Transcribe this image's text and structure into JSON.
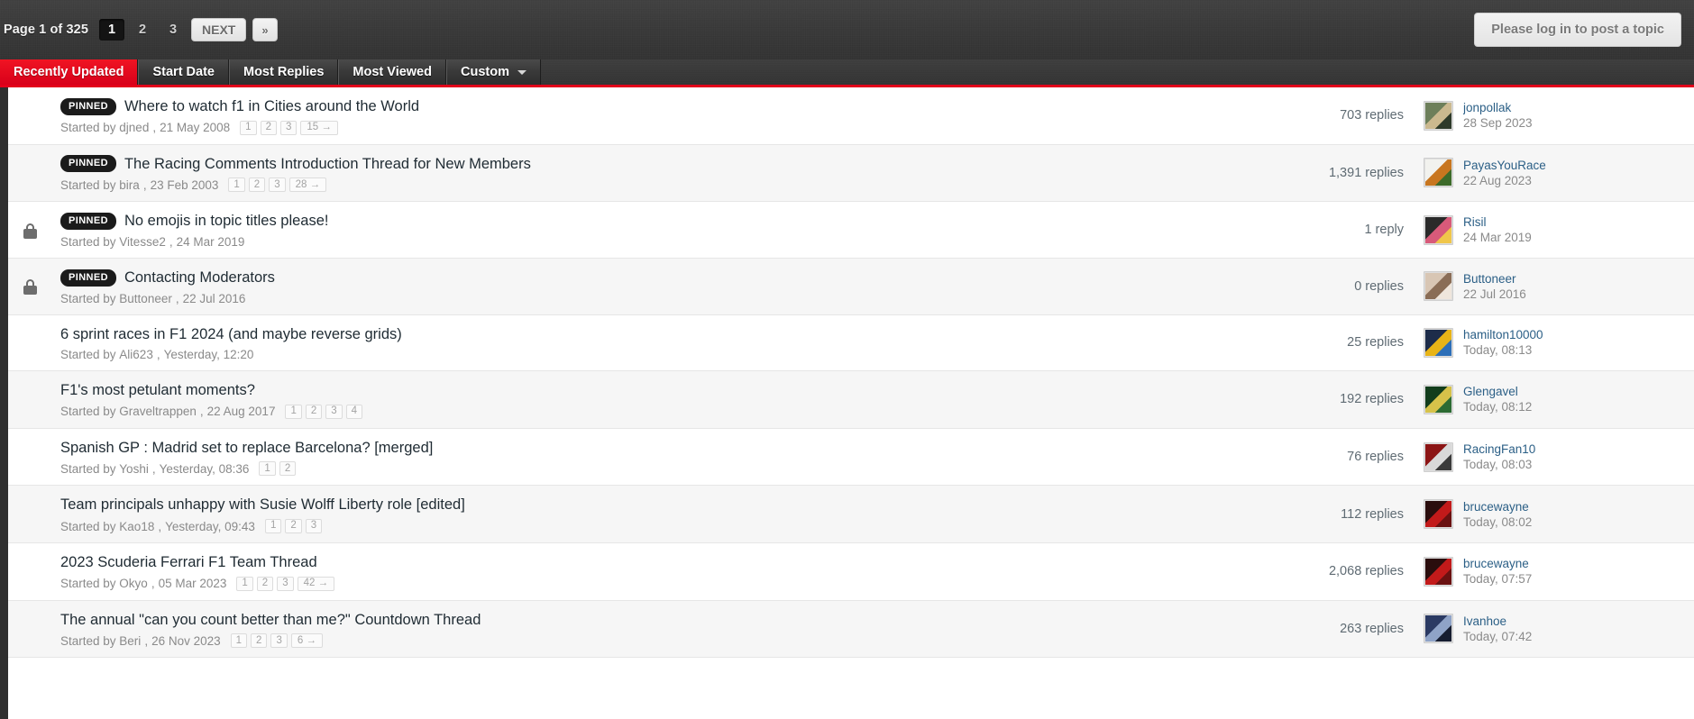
{
  "header": {
    "page_label": "Page 1 of 325",
    "pages": [
      "1",
      "2",
      "3"
    ],
    "active_page": "1",
    "next_label": "NEXT",
    "last_label": "»",
    "login_button": "Please log in to post a topic"
  },
  "tabs": [
    {
      "label": "Recently Updated",
      "active": true,
      "caret": false
    },
    {
      "label": "Start Date",
      "active": false,
      "caret": false
    },
    {
      "label": "Most Replies",
      "active": false,
      "caret": false
    },
    {
      "label": "Most Viewed",
      "active": false,
      "caret": false
    },
    {
      "label": "Custom",
      "active": false,
      "caret": true
    }
  ],
  "labels": {
    "started_by": "Started by",
    "comma": ",",
    "pinned": "PINNED"
  },
  "colors": {
    "accent_red": "#e2001a",
    "topbar_dark": "#3b3b3b",
    "link_blue": "#2b5f86",
    "muted_gray": "#8a8a8a"
  },
  "topics": [
    {
      "pinned": true,
      "locked": false,
      "title": "Where to watch f1 in Cities around the World",
      "starter": "djned",
      "start_date": "21 May 2008",
      "minipages": [
        "1",
        "2",
        "3",
        "15 →"
      ],
      "replies": "703 replies",
      "last_user": "jonpollak",
      "last_date": "28 Sep 2023",
      "avatar": "photo-portrait"
    },
    {
      "pinned": true,
      "locked": false,
      "title": "The Racing Comments Introduction Thread for New Members",
      "starter": "bira",
      "start_date": "23 Feb 2003",
      "minipages": [
        "1",
        "2",
        "3",
        "28 →"
      ],
      "replies": "1,391 replies",
      "last_user": "PayasYouRace",
      "last_date": "22 Aug 2023",
      "avatar": "cartoon-figure"
    },
    {
      "pinned": true,
      "locked": true,
      "title": "No emojis in topic titles please!",
      "starter": "Vitesse2",
      "start_date": "24 Mar 2019",
      "minipages": [],
      "replies": "1 reply",
      "last_user": "Risil",
      "last_date": "24 Mar 2019",
      "avatar": "penguin-scarf"
    },
    {
      "pinned": true,
      "locked": true,
      "title": "Contacting Moderators",
      "starter": "Buttoneer",
      "start_date": "22 Jul 2016",
      "minipages": [],
      "replies": "0 replies",
      "last_user": "Buttoneer",
      "last_date": "22 Jul 2016",
      "avatar": "person-light"
    },
    {
      "pinned": false,
      "locked": false,
      "title": "6 sprint races in F1 2024 (and maybe reverse grids)",
      "starter": "Ali623",
      "start_date": "Yesterday, 12:20",
      "minipages": [],
      "replies": "25 replies",
      "last_user": "hamilton10000",
      "last_date": "Today, 08:13",
      "avatar": "race-car"
    },
    {
      "pinned": false,
      "locked": false,
      "title": "F1's most petulant moments?",
      "starter": "Graveltrappen",
      "start_date": "22 Aug 2017",
      "minipages": [
        "1",
        "2",
        "3",
        "4"
      ],
      "replies": "192 replies",
      "last_user": "Glengavel",
      "last_date": "Today, 08:12",
      "avatar": "green-badge"
    },
    {
      "pinned": false,
      "locked": false,
      "title": "Spanish GP : Madrid set to replace Barcelona? [merged]",
      "starter": "Yoshi",
      "start_date": "Yesterday, 08:36",
      "minipages": [
        "1",
        "2"
      ],
      "replies": "76 replies",
      "last_user": "RacingFan10",
      "last_date": "Today, 08:03",
      "avatar": "red-car"
    },
    {
      "pinned": false,
      "locked": false,
      "title": "Team principals unhappy with Susie Wolff Liberty role [edited]",
      "starter": "Kao18",
      "start_date": "Yesterday, 09:43",
      "minipages": [
        "1",
        "2",
        "3"
      ],
      "replies": "112 replies",
      "last_user": "brucewayne",
      "last_date": "Today, 08:02",
      "avatar": "dark-red-logo"
    },
    {
      "pinned": false,
      "locked": false,
      "title": "2023 Scuderia Ferrari F1 Team Thread",
      "starter": "Okyo",
      "start_date": "05 Mar 2023",
      "minipages": [
        "1",
        "2",
        "3",
        "42 →"
      ],
      "replies": "2,068 replies",
      "last_user": "brucewayne",
      "last_date": "Today, 07:57",
      "avatar": "dark-red-logo"
    },
    {
      "pinned": false,
      "locked": false,
      "title": "The annual \"can you count better than me?\" Countdown Thread",
      "starter": "Beri",
      "start_date": "26 Nov 2023",
      "minipages": [
        "1",
        "2",
        "3",
        "6 →"
      ],
      "replies": "263 replies",
      "last_user": "Ivanhoe",
      "last_date": "Today, 07:42",
      "avatar": "blue-portrait"
    }
  ]
}
